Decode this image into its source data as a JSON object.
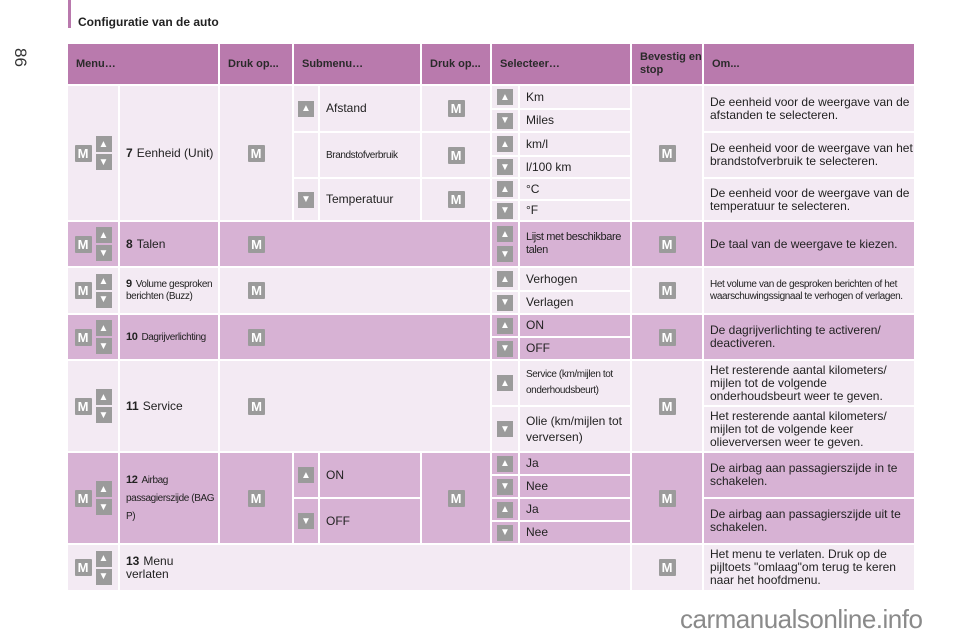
{
  "page": {
    "title": "Configuratie van de auto",
    "page_number": "86",
    "watermark": "carmanualsonline.info"
  },
  "icons": {
    "m_button": "M",
    "up_arrow": "▲",
    "down_arrow": "▼"
  },
  "colors": {
    "header": "#b97aad",
    "row_light": "#f3eaf3",
    "row_dark": "#d7b2d4",
    "button_gray": "#9b9b9b"
  },
  "header": {
    "menu": "Menu…",
    "press1": "Druk op...",
    "submenu": "Submenu…",
    "press2": "Druk op...",
    "select": "Selecteer…",
    "confirm": "Bevestig en stop",
    "purpose": "Om..."
  },
  "rows": [
    {
      "num": "7",
      "label": "Eenheid (Unit)",
      "submenus": [
        {
          "label": "Afstand",
          "options": [
            "Km",
            "Miles"
          ],
          "desc": "De eenheid voor de weergave van de afstanden te selecteren."
        },
        {
          "label": "Brandstofverbruik",
          "options": [
            "km/l",
            "l/100 km"
          ],
          "desc": "De eenheid voor de weergave van het brandstofverbruik te selecteren."
        },
        {
          "label": "Temperatuur",
          "options": [
            "°C",
            "°F"
          ],
          "desc": "De eenheid voor de weergave van de temperatuur te selecteren."
        }
      ]
    },
    {
      "num": "8",
      "label": "Talen",
      "options": [
        "Lijst met beschikbare talen"
      ],
      "desc": "De taal van de weergave te kiezen."
    },
    {
      "num": "9",
      "label": "Volume gesproken berichten (Buzz)",
      "options": [
        "Verhogen",
        "Verlagen"
      ],
      "desc": "Het volume van de gesproken berichten of het waarschuwingssignaal te verhogen of verlagen."
    },
    {
      "num": "10",
      "label": "Dagrijverlichting",
      "options": [
        "ON",
        "OFF"
      ],
      "desc": "De dagrijverlichting te activeren/ deactiveren."
    },
    {
      "num": "11",
      "label": "Service",
      "options": [
        "Service (km/mijlen tot onderhoudsbeurt)",
        "Olie (km/mijlen tot verversen)"
      ],
      "descs": [
        "Het resterende aantal kilometers/ mijlen tot de volgende onderhoudsbeurt weer te geven.",
        "Het resterende aantal kilometers/ mijlen tot de volgende keer olieverversen weer te geven."
      ]
    },
    {
      "num": "12",
      "label": "Airbag passagierszijde (BAG P)",
      "submenus": [
        {
          "label": "ON",
          "options": [
            "Ja",
            "Nee"
          ],
          "desc": "De airbag aan passagierszijde in te schakelen."
        },
        {
          "label": "OFF",
          "options": [
            "Ja",
            "Nee"
          ],
          "desc": "De airbag aan passagierszijde uit te schakelen."
        }
      ]
    },
    {
      "num": "13",
      "label": "Menu verlaten",
      "desc": "Het menu te verlaten. Druk op de pijltoets \"omlaag\"om terug te keren naar het hoofdmenu."
    }
  ]
}
